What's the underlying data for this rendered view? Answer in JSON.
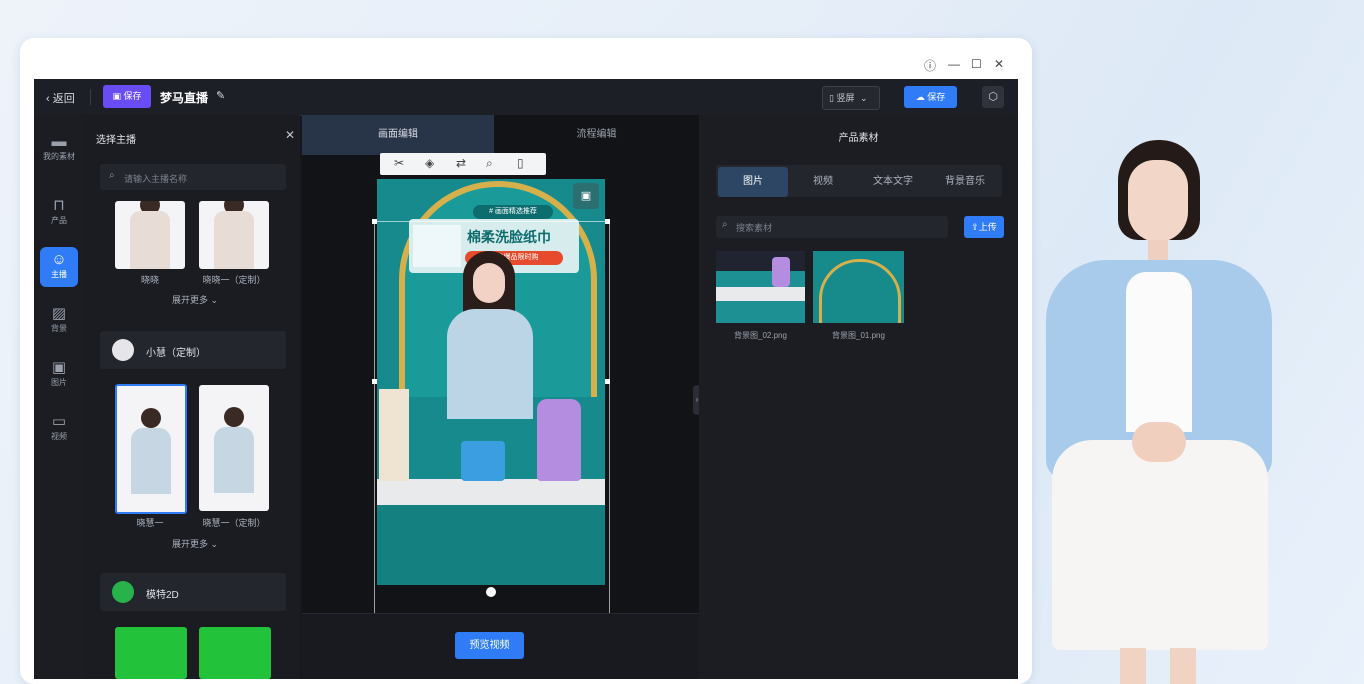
{
  "window": {
    "controls": [
      "ⓘ",
      "—",
      "☐",
      "✕"
    ]
  },
  "topbar": {
    "back_label": "返回",
    "save_badge": "保存",
    "project_title": "梦马直播",
    "device_select": "竖屏",
    "save_button": "保存"
  },
  "rail": {
    "items": [
      {
        "label": "我的素材",
        "icon": "folder-icon"
      },
      {
        "label": "产品",
        "icon": "bag-icon"
      },
      {
        "label": "主播",
        "icon": "anchor-icon"
      },
      {
        "label": "背景",
        "icon": "background-icon"
      },
      {
        "label": "图片",
        "icon": "image-icon"
      },
      {
        "label": "视频",
        "icon": "video-icon"
      }
    ]
  },
  "left_panel": {
    "title": "选择主播",
    "search_placeholder": "请输入主播名称",
    "group1": {
      "captions": [
        "晓晓",
        "晓晓一（定制）"
      ],
      "expand": "展开更多 ⌄"
    },
    "group2": {
      "name": "小慧（定制）",
      "captions": [
        "晓慧一",
        "晓慧一（定制）"
      ],
      "expand": "展开更多 ⌄"
    },
    "group3": {
      "name": "模特2D"
    }
  },
  "canvas": {
    "tabs": [
      "画面编辑",
      "流程编辑"
    ],
    "poster_badge": "# 画面精选推荐",
    "poster_headline": "棉柔洗脸纸巾",
    "poster_subline": "超值爆品限时购",
    "preview_button": "预览视频"
  },
  "right_panel": {
    "title": "产品素材",
    "tabs": [
      "图片",
      "视频",
      "文本文字",
      "背景音乐"
    ],
    "search_placeholder": "搜索素材",
    "upload_button": "上传",
    "assets": [
      {
        "caption": "背景图_02.png"
      },
      {
        "caption": "背景图_01.png"
      }
    ]
  },
  "colors": {
    "accent": "#2f7cf6",
    "brand_purple": "#6a4cf5",
    "panel_dark": "#1b1d23",
    "teal_poster": "#17888a"
  }
}
